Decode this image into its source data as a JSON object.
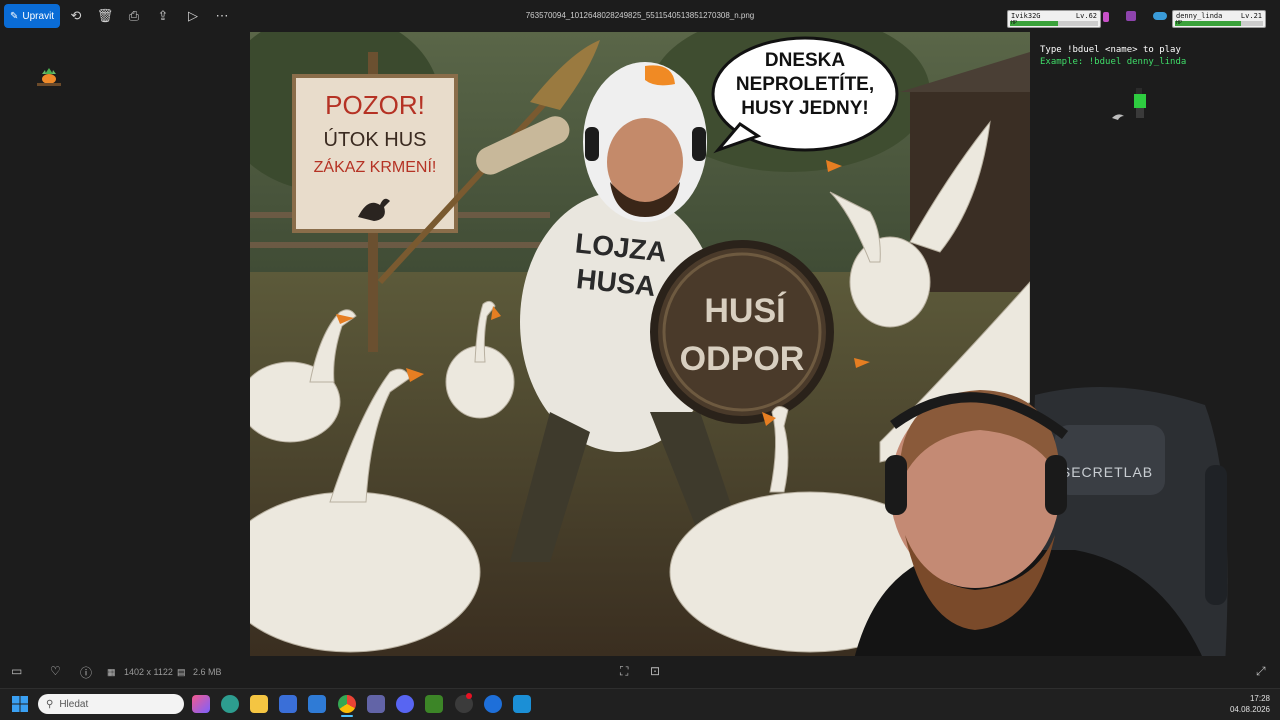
{
  "toolbar": {
    "edit_label": "Upravit",
    "file_name": "763570094_1012648028249825_5511540513851270308_n.png"
  },
  "overlay": {
    "players": [
      {
        "name": "Ivik32G",
        "level": "Lv.62",
        "hp_label": "HP",
        "hp_fraction": 0.55
      },
      {
        "name": "denny_linda",
        "level": "Lv.21",
        "hp_label": "HP",
        "hp_fraction": 0.75
      }
    ],
    "duel_line1": "Type !bduel <name> to play",
    "duel_line2": "Example: !bduel denny_linda"
  },
  "photo": {
    "sign_line1": "POZOR!",
    "sign_line2": "ÚTOK HUS",
    "sign_line3": "ZÁKAZ KRMENÍ!",
    "speech_line1": "DNESKA",
    "speech_line2": "NEPROLETÍTE,",
    "speech_line3": "HUSY JEDNY!",
    "shirt_line1": "LOJZA",
    "shirt_line2": "HUSA",
    "shield_line1": "HUSÍ",
    "shield_line2": "ODPOR"
  },
  "webcam": {
    "chair_brand": "SECRETLAB"
  },
  "infobar": {
    "dimensions": "1402 x 1122",
    "file_size": "2.6 MB"
  },
  "taskbar": {
    "search_placeholder": "Hledat",
    "time": "17:28",
    "date": "04.08.2026"
  },
  "colors": {
    "accent": "#0a6cd6",
    "duel_green": "#3fdc68"
  }
}
